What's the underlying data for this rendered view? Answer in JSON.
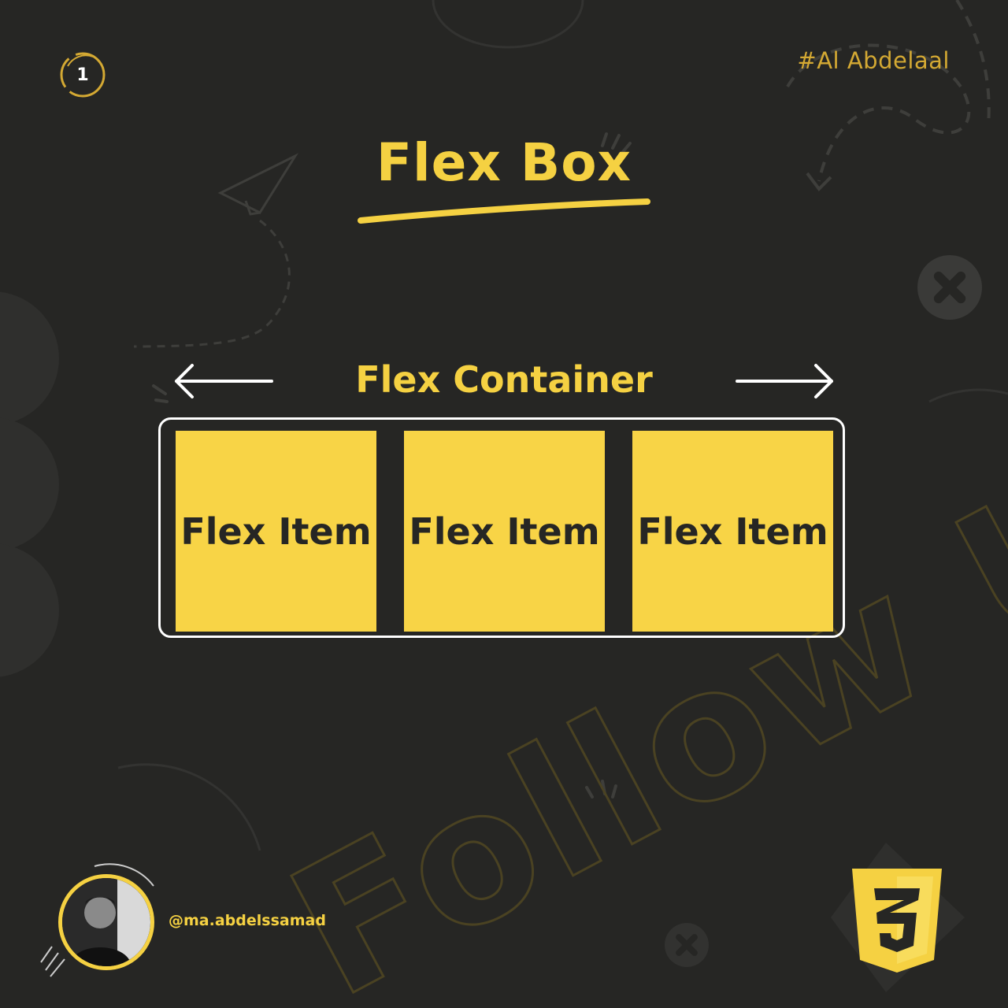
{
  "page_number": "1",
  "hashtag": "#Al Abdelaal",
  "title": "Flex Box",
  "container_label": "Flex Container",
  "flex_items": [
    "Flex Item",
    "Flex Item",
    "Flex Item"
  ],
  "author_handle": "@ma.abdelssamad",
  "watermark_text": "Follow Us!",
  "colors": {
    "background": "#262624",
    "accent": "#f5d142",
    "item_fill": "#f8d446",
    "border": "#ffffff"
  },
  "icons": [
    "arrow-left-icon",
    "arrow-right-icon",
    "css3-logo-icon",
    "paper-plane-icon",
    "plus-circle-icon"
  ]
}
